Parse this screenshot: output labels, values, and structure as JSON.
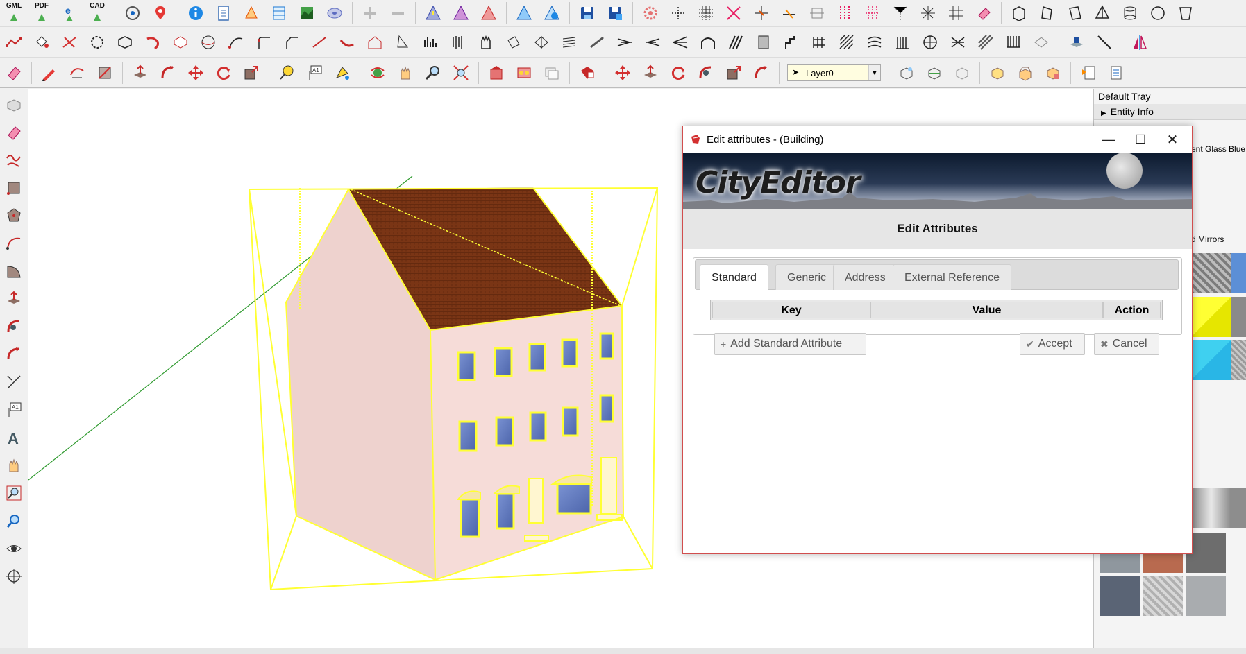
{
  "toolbar1": {
    "text_buttons": [
      {
        "name": "gml-export",
        "label": "GML"
      },
      {
        "name": "pdf-export",
        "label": "PDF"
      },
      {
        "name": "cad-export",
        "label": "CAD"
      }
    ]
  },
  "layer_select": {
    "value": "Layer0"
  },
  "tray": {
    "title": "Default Tray",
    "section": "Entity Info",
    "material_name": "ent Glass Blue",
    "material_list": "d Mirrors"
  },
  "dialog": {
    "title": "Edit attributes -  (Building)",
    "logo": "CityEditor",
    "heading": "Edit Attributes",
    "tabs": [
      "Standard",
      "Generic",
      "Address",
      "External Reference"
    ],
    "active_tab": "Standard",
    "columns": [
      "Key",
      "Value",
      "Action"
    ],
    "add_label": "Add Standard Attribute",
    "accept_label": "Accept",
    "cancel_label": "Cancel"
  },
  "colors": {
    "selection": "#ffff33",
    "wall": "#f3d7d3",
    "roof": "#7a3515",
    "window": "#6a82c8",
    "dialog_border": "#d14e4e",
    "axis_green": "#2e9a2e"
  }
}
